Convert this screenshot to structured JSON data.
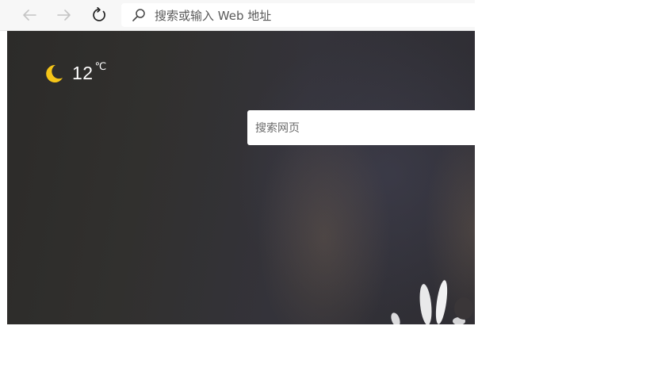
{
  "toolbar": {
    "back_icon": "arrow-left-icon",
    "forward_icon": "arrow-right-icon",
    "reload_icon": "reload-icon",
    "address_placeholder": "搜索或输入 Web 地址",
    "address_icon": "search-icon"
  },
  "newtab": {
    "weather": {
      "icon": "moon-icon",
      "temperature": "12",
      "unit": "℃"
    },
    "search_placeholder": "搜索网页"
  },
  "colors": {
    "toolbar_bg": "#f7f7f7",
    "disabled_icon": "#c4c4c4",
    "active_icon": "#222222",
    "moon": "#f5c518"
  }
}
